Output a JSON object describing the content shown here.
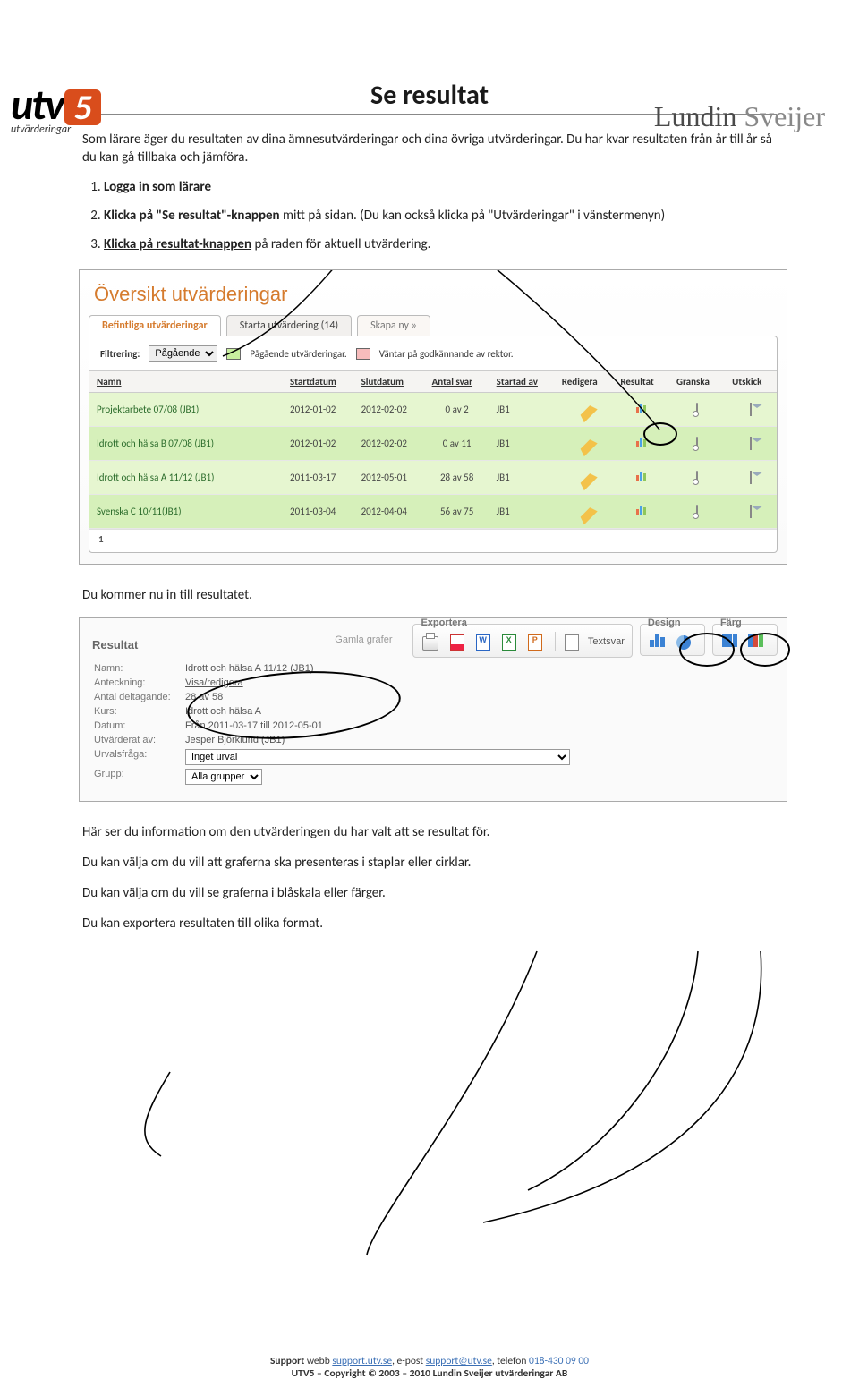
{
  "logo_left": {
    "brand": "utv",
    "five": "5",
    "sub": "utvärderingar"
  },
  "logo_right": {
    "a": "Lundin ",
    "b": "Sveijer"
  },
  "title": "Se resultat",
  "intro": "Som lärare äger du resultaten av dina ämnesutvärderingar och dina övriga utvärderingar. Du har kvar resultaten från år till år så du kan gå tillbaka och jämföra.",
  "steps": {
    "s1_b": "Logga in som lärare",
    "s2_b": "Klicka på \"Se resultat\"-knappen",
    "s2_rest": " mitt på sidan. (Du kan också klicka på \"Utvärderingar\" i vänstermenyn)",
    "s3_b": "Klicka på resultat-knappen",
    "s3_rest": " på raden för aktuell utvärdering."
  },
  "shot1": {
    "heading": "Översikt utvärderingar",
    "tabs": {
      "active": "Befintliga utvärderingar",
      "t2": "Starta utvärdering (14)",
      "t3": "Skapa ny »"
    },
    "filter": {
      "label": "Filtrering:",
      "value": "Pågående",
      "leg1": "Pågående utvärderingar.",
      "leg2": "Väntar på godkännande av rektor."
    },
    "columns": [
      "Namn",
      "Startdatum",
      "Slutdatum",
      "Antal svar",
      "Startad av",
      "Redigera",
      "Resultat",
      "Granska",
      "Utskick"
    ],
    "rows": [
      {
        "namn": "Projektarbete 07/08 (JB1)",
        "start": "2012-01-02",
        "slut": "2012-02-02",
        "svar": "0 av 2",
        "av": "JB1"
      },
      {
        "namn": "Idrott och hälsa B 07/08 (JB1)",
        "start": "2012-01-02",
        "slut": "2012-02-02",
        "svar": "0 av 11",
        "av": "JB1"
      },
      {
        "namn": "Idrott och hälsa A 11/12 (JB1)",
        "start": "2011-03-17",
        "slut": "2012-05-01",
        "svar": "28 av 58",
        "av": "JB1"
      },
      {
        "namn": "Svenska C 10/11(JB1)",
        "start": "2011-03-04",
        "slut": "2012-04-04",
        "svar": "56 av 75",
        "av": "JB1"
      }
    ],
    "pager": "1"
  },
  "mid_text": "Du kommer nu in till resultatet.",
  "shot2": {
    "groups": {
      "export": "Exportera",
      "design": "Design",
      "color": "Färg"
    },
    "textsvar": "Textsvar",
    "gamla": "Gamla grafer",
    "resultat_label": "Resultat",
    "details": {
      "Namn:": "Idrott och hälsa A 11/12 (JB1)",
      "Anteckning:": "Visa/redigera",
      "Antal deltagande:": "28 av 58",
      "Kurs:": "Idrott och hälsa A",
      "Datum:": "Från 2011-03-17 till 2012-05-01",
      "Utvärderat av:": "Jesper Björklund (JB1)",
      "Urvalsfråga:": "",
      "Grupp:": ""
    },
    "urval_value": "Inget urval",
    "grupp_value": "Alla grupper"
  },
  "outro": {
    "p1": "Här ser du information om den utvärderingen du har valt att se resultat för.",
    "p2": "Du kan välja om du vill att graferna ska presenteras i staplar eller cirklar.",
    "p3": "Du kan välja om du vill se graferna i blåskala eller färger.",
    "p4": "Du kan exportera resultaten till olika format."
  },
  "footer": {
    "l1a": "Support ",
    "l1b": "webb ",
    "l1_link1": "support.utv.se",
    "l1c": ", e-post ",
    "l1_link2": "support@utv.se",
    "l1d": ", telefon ",
    "l1_tel": "018-430 09 00",
    "l2": "UTV5 – Copyright © 2003 – 2010 Lundin Sveijer utvärderingar AB"
  }
}
